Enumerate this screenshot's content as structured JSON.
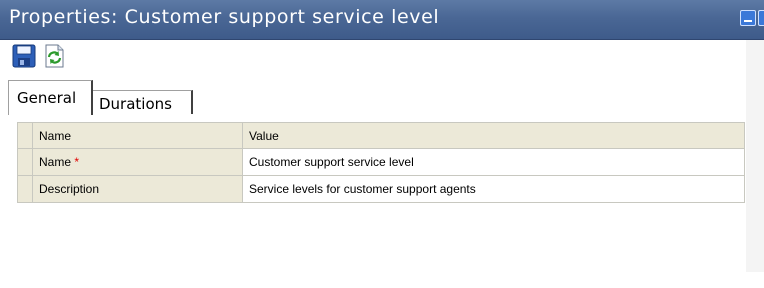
{
  "window": {
    "title": "Properties: Customer support service level"
  },
  "toolbar": {
    "buttons": [
      {
        "icon": "save-icon"
      },
      {
        "icon": "refresh-icon"
      }
    ]
  },
  "tabs": [
    {
      "label": "General",
      "active": true
    },
    {
      "label": "Durations",
      "active": false
    }
  ],
  "grid": {
    "headers": {
      "name": "Name",
      "value": "Value"
    },
    "rows": [
      {
        "name": "Name",
        "required_marker": "*",
        "value": "Customer support service level"
      },
      {
        "name": "Description",
        "value": "Service levels for customer support agents"
      }
    ]
  },
  "colors": {
    "titlebar": "#4a6795",
    "grid_header": "#ece9d8",
    "required": "#e00000"
  }
}
